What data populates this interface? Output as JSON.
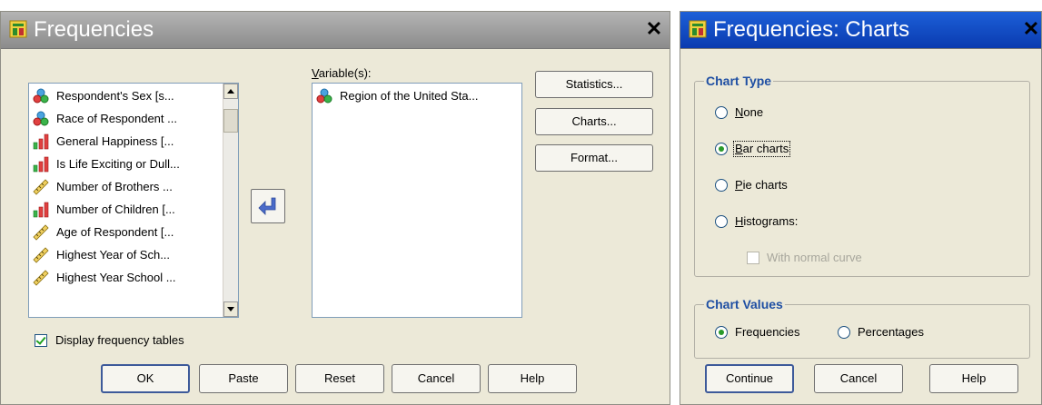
{
  "frequencies": {
    "title": "Frequencies",
    "source_list": [
      {
        "label": "Respondent's Sex [s...",
        "icon": "nominal-icon"
      },
      {
        "label": "Race of Respondent ...",
        "icon": "nominal-icon"
      },
      {
        "label": "General Happiness [...",
        "icon": "ordinal-icon"
      },
      {
        "label": "Is Life Exciting or Dull...",
        "icon": "ordinal-icon"
      },
      {
        "label": "Number of Brothers ...",
        "icon": "scale-icon"
      },
      {
        "label": "Number of Children [...",
        "icon": "ordinal-icon"
      },
      {
        "label": "Age of Respondent [...",
        "icon": "scale-icon"
      },
      {
        "label": "Highest Year of Sch...",
        "icon": "scale-icon"
      },
      {
        "label": "Highest Year School ...",
        "icon": "scale-icon"
      }
    ],
    "variables_label": "Variable(s):",
    "variables": [
      {
        "label": "Region of the United Sta...",
        "icon": "nominal-icon"
      }
    ],
    "side_buttons": {
      "statistics": "Statistics...",
      "charts": "Charts...",
      "format": "Format..."
    },
    "display_tables": {
      "label": "Display frequency tables",
      "checked": true
    },
    "buttons": {
      "ok": "OK",
      "paste": "Paste",
      "reset": "Reset",
      "cancel": "Cancel",
      "help": "Help"
    }
  },
  "charts": {
    "title": "Frequencies: Charts",
    "chart_type": {
      "title": "Chart Type",
      "options": [
        "None",
        "Bar charts",
        "Pie charts",
        "Histograms:"
      ],
      "selected": "Bar charts",
      "normal_curve": {
        "label": "With normal curve",
        "checked": false,
        "enabled": false
      }
    },
    "chart_values": {
      "title": "Chart Values",
      "options": [
        "Frequencies",
        "Percentages"
      ],
      "selected": "Frequencies"
    },
    "buttons": {
      "continue": "Continue",
      "cancel": "Cancel",
      "help": "Help"
    }
  },
  "colors": {
    "title_inactive": "#9c9c9c",
    "title_active": "#0a3bb0",
    "group_title": "#1f4fa3",
    "dialog_bg": "#ece9d8"
  }
}
